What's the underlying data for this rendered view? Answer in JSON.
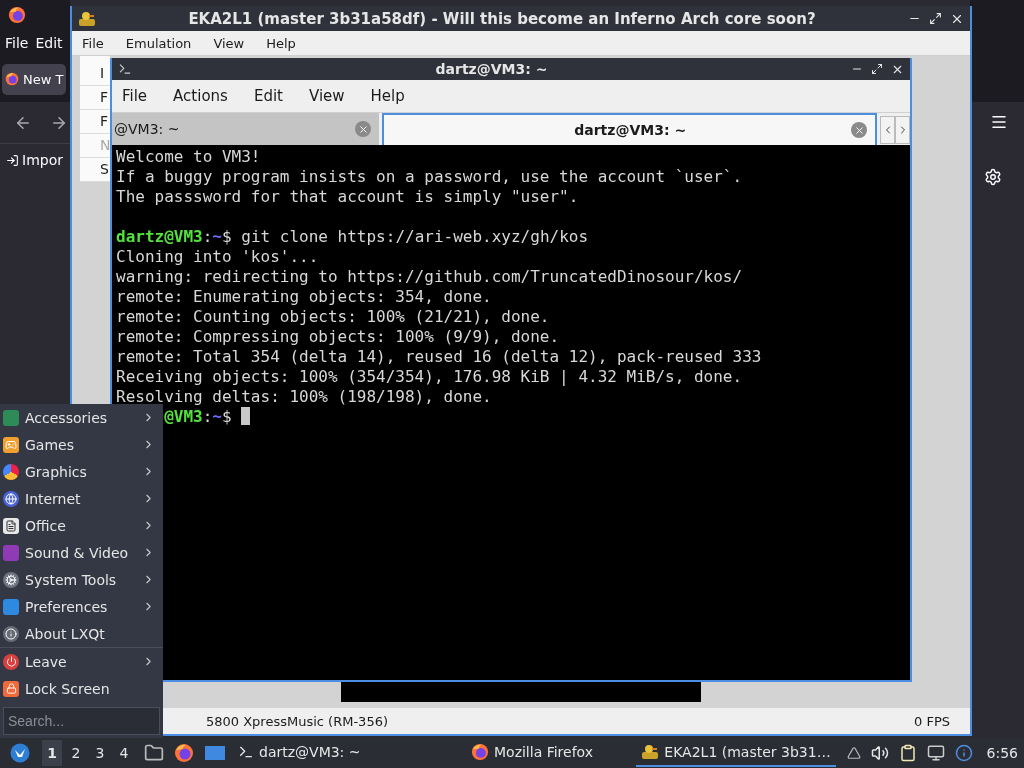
{
  "firefox": {
    "menu": [
      "File",
      "Edit"
    ],
    "tab": {
      "label": "New T",
      "selected": true
    },
    "import_button": "Impor"
  },
  "emulator": {
    "title": "EKA2L1 (master 3b31a58df) - Will this become an Inferno Arch core soon?",
    "menu": [
      "File",
      "Emulation",
      "View",
      "Help"
    ],
    "side_list": [
      {
        "label": "I",
        "disabled": false
      },
      {
        "label": "F",
        "disabled": false
      },
      {
        "label": "F",
        "disabled": false
      },
      {
        "label": "N",
        "disabled": true
      },
      {
        "label": "S",
        "disabled": false
      }
    ],
    "status_bar": {
      "device": "5800 XpressMusic (RM-356)",
      "fps": "0 FPS"
    }
  },
  "terminal": {
    "title": "dartz@VM3: ~",
    "menu": [
      "File",
      "Actions",
      "Edit",
      "View",
      "Help"
    ],
    "tabs": [
      {
        "label": "@VM3: ~",
        "selected": false
      },
      {
        "label": "dartz@VM3: ~",
        "selected": true
      }
    ],
    "lines": [
      {
        "kind": "text",
        "text": "Welcome to VM3!"
      },
      {
        "kind": "text",
        "text": "If a buggy program insists on a password, use the account `user`."
      },
      {
        "kind": "text",
        "text": "The passsword for that account is simply \"user\"."
      },
      {
        "kind": "blank"
      },
      {
        "kind": "prompt",
        "user": "dartz@VM3",
        "colon": ":",
        "path": "~",
        "symbol": "$",
        "command": "git clone https://ari-web.xyz/gh/kos"
      },
      {
        "kind": "text",
        "text": "Cloning into 'kos'..."
      },
      {
        "kind": "text",
        "text": "warning: redirecting to https://github.com/TruncatedDinosour/kos/"
      },
      {
        "kind": "text",
        "text": "remote: Enumerating objects: 354, done."
      },
      {
        "kind": "text",
        "text": "remote: Counting objects: 100% (21/21), done."
      },
      {
        "kind": "text",
        "text": "remote: Compressing objects: 100% (9/9), done."
      },
      {
        "kind": "text",
        "text": "remote: Total 354 (delta 14), reused 16 (delta 12), pack-reused 333"
      },
      {
        "kind": "text",
        "text": "Receiving objects: 100% (354/354), 176.98 KiB | 4.32 MiB/s, done."
      },
      {
        "kind": "text",
        "text": "Resolving deltas: 100% (198/198), done."
      },
      {
        "kind": "prompt_cut",
        "user": "@VM3",
        "colon": ":",
        "path": "~",
        "symbol": "$",
        "cursor": true
      }
    ]
  },
  "start_menu": {
    "items": [
      {
        "label": "Accessories",
        "submenu": true,
        "separator_before": false
      },
      {
        "label": "Games",
        "submenu": true,
        "separator_before": false
      },
      {
        "label": "Graphics",
        "submenu": true,
        "separator_before": false
      },
      {
        "label": "Internet",
        "submenu": true,
        "separator_before": false
      },
      {
        "label": "Office",
        "submenu": true,
        "separator_before": false
      },
      {
        "label": "Sound & Video",
        "submenu": true,
        "separator_before": false
      },
      {
        "label": "System Tools",
        "submenu": true,
        "separator_before": false
      },
      {
        "label": "Preferences",
        "submenu": true,
        "separator_before": false
      },
      {
        "label": "About LXQt",
        "submenu": false,
        "separator_before": false
      },
      {
        "label": "Leave",
        "submenu": true,
        "separator_before": true
      },
      {
        "label": "Lock Screen",
        "submenu": false,
        "separator_before": false
      }
    ],
    "search": {
      "placeholder": "Search..."
    }
  },
  "taskbar": {
    "workspaces": [
      {
        "label": "1",
        "selected": true
      },
      {
        "label": "2",
        "selected": false
      },
      {
        "label": "3",
        "selected": false
      },
      {
        "label": "4",
        "selected": false
      }
    ],
    "tasks": [
      {
        "label": "dartz@VM3: ~",
        "selected": false
      },
      {
        "label": "Mozilla Firefox",
        "selected": false
      },
      {
        "label": "EKA2L1 (master 3b31…",
        "selected": true
      }
    ],
    "clock": "6:56"
  }
}
